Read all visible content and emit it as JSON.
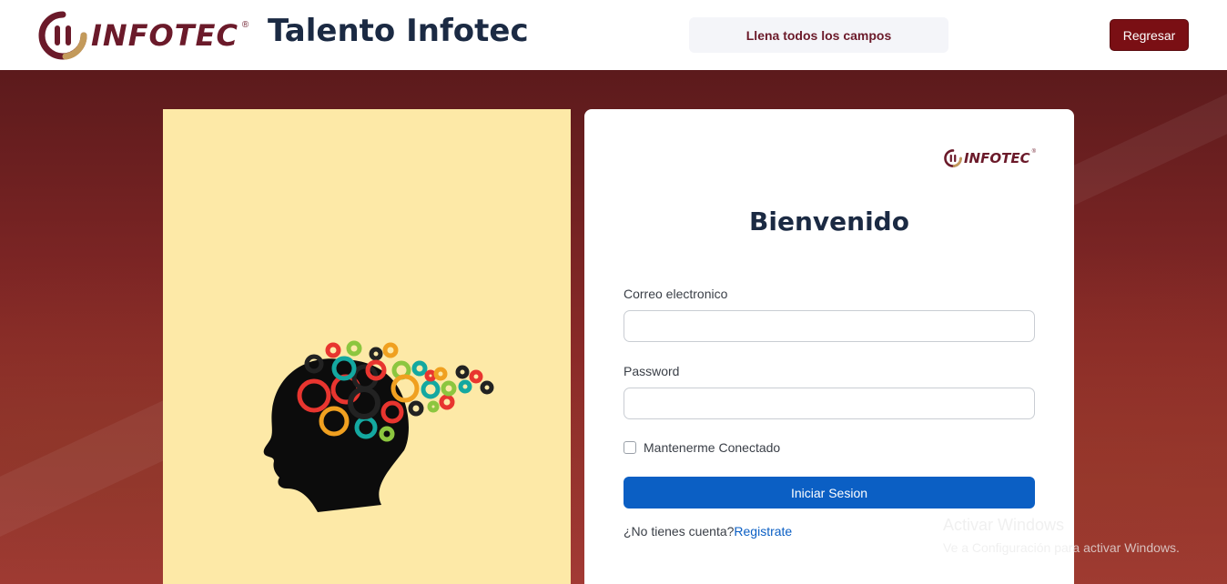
{
  "header": {
    "brand_name": "INFOTEC",
    "brand_reg": "®",
    "app_title": "Talento Infotec",
    "notice": "Llena todos los campos",
    "back_button": "Regresar"
  },
  "card": {
    "logo_word": "INFOTEC",
    "logo_reg": "®",
    "heading": "Bienvenido",
    "email_label": "Correo electronico",
    "email_value": "",
    "password_label": "Password",
    "password_value": "",
    "remember_label": "Mantenerme Conectado",
    "remember_checked": false,
    "submit_label": "Iniciar Sesion",
    "signup_prompt": "¿No tienes cuenta?",
    "signup_link": "Registrate"
  },
  "watermark": {
    "title": "Activar Windows",
    "subtitle": "Ve a Configuración para activar Windows."
  },
  "colors": {
    "brand": "#6b1a2a",
    "back_button": "#7a0f14",
    "primary": "#0b5fc4",
    "illustration_bg": "#fde9a7"
  }
}
